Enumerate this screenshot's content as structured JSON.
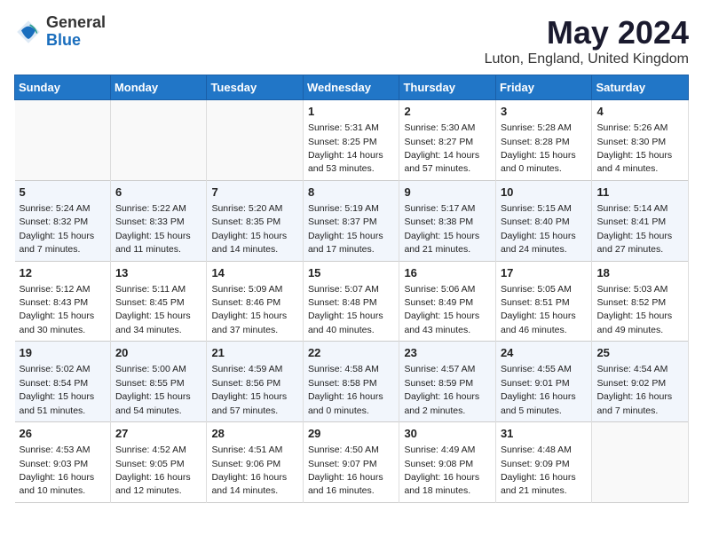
{
  "header": {
    "logo_general": "General",
    "logo_blue": "Blue",
    "title": "May 2024",
    "subtitle": "Luton, England, United Kingdom"
  },
  "days_header": [
    "Sunday",
    "Monday",
    "Tuesday",
    "Wednesday",
    "Thursday",
    "Friday",
    "Saturday"
  ],
  "weeks": [
    [
      {
        "num": "",
        "info": ""
      },
      {
        "num": "",
        "info": ""
      },
      {
        "num": "",
        "info": ""
      },
      {
        "num": "1",
        "info": "Sunrise: 5:31 AM\nSunset: 8:25 PM\nDaylight: 14 hours\nand 53 minutes."
      },
      {
        "num": "2",
        "info": "Sunrise: 5:30 AM\nSunset: 8:27 PM\nDaylight: 14 hours\nand 57 minutes."
      },
      {
        "num": "3",
        "info": "Sunrise: 5:28 AM\nSunset: 8:28 PM\nDaylight: 15 hours\nand 0 minutes."
      },
      {
        "num": "4",
        "info": "Sunrise: 5:26 AM\nSunset: 8:30 PM\nDaylight: 15 hours\nand 4 minutes."
      }
    ],
    [
      {
        "num": "5",
        "info": "Sunrise: 5:24 AM\nSunset: 8:32 PM\nDaylight: 15 hours\nand 7 minutes."
      },
      {
        "num": "6",
        "info": "Sunrise: 5:22 AM\nSunset: 8:33 PM\nDaylight: 15 hours\nand 11 minutes."
      },
      {
        "num": "7",
        "info": "Sunrise: 5:20 AM\nSunset: 8:35 PM\nDaylight: 15 hours\nand 14 minutes."
      },
      {
        "num": "8",
        "info": "Sunrise: 5:19 AM\nSunset: 8:37 PM\nDaylight: 15 hours\nand 17 minutes."
      },
      {
        "num": "9",
        "info": "Sunrise: 5:17 AM\nSunset: 8:38 PM\nDaylight: 15 hours\nand 21 minutes."
      },
      {
        "num": "10",
        "info": "Sunrise: 5:15 AM\nSunset: 8:40 PM\nDaylight: 15 hours\nand 24 minutes."
      },
      {
        "num": "11",
        "info": "Sunrise: 5:14 AM\nSunset: 8:41 PM\nDaylight: 15 hours\nand 27 minutes."
      }
    ],
    [
      {
        "num": "12",
        "info": "Sunrise: 5:12 AM\nSunset: 8:43 PM\nDaylight: 15 hours\nand 30 minutes."
      },
      {
        "num": "13",
        "info": "Sunrise: 5:11 AM\nSunset: 8:45 PM\nDaylight: 15 hours\nand 34 minutes."
      },
      {
        "num": "14",
        "info": "Sunrise: 5:09 AM\nSunset: 8:46 PM\nDaylight: 15 hours\nand 37 minutes."
      },
      {
        "num": "15",
        "info": "Sunrise: 5:07 AM\nSunset: 8:48 PM\nDaylight: 15 hours\nand 40 minutes."
      },
      {
        "num": "16",
        "info": "Sunrise: 5:06 AM\nSunset: 8:49 PM\nDaylight: 15 hours\nand 43 minutes."
      },
      {
        "num": "17",
        "info": "Sunrise: 5:05 AM\nSunset: 8:51 PM\nDaylight: 15 hours\nand 46 minutes."
      },
      {
        "num": "18",
        "info": "Sunrise: 5:03 AM\nSunset: 8:52 PM\nDaylight: 15 hours\nand 49 minutes."
      }
    ],
    [
      {
        "num": "19",
        "info": "Sunrise: 5:02 AM\nSunset: 8:54 PM\nDaylight: 15 hours\nand 51 minutes."
      },
      {
        "num": "20",
        "info": "Sunrise: 5:00 AM\nSunset: 8:55 PM\nDaylight: 15 hours\nand 54 minutes."
      },
      {
        "num": "21",
        "info": "Sunrise: 4:59 AM\nSunset: 8:56 PM\nDaylight: 15 hours\nand 57 minutes."
      },
      {
        "num": "22",
        "info": "Sunrise: 4:58 AM\nSunset: 8:58 PM\nDaylight: 16 hours\nand 0 minutes."
      },
      {
        "num": "23",
        "info": "Sunrise: 4:57 AM\nSunset: 8:59 PM\nDaylight: 16 hours\nand 2 minutes."
      },
      {
        "num": "24",
        "info": "Sunrise: 4:55 AM\nSunset: 9:01 PM\nDaylight: 16 hours\nand 5 minutes."
      },
      {
        "num": "25",
        "info": "Sunrise: 4:54 AM\nSunset: 9:02 PM\nDaylight: 16 hours\nand 7 minutes."
      }
    ],
    [
      {
        "num": "26",
        "info": "Sunrise: 4:53 AM\nSunset: 9:03 PM\nDaylight: 16 hours\nand 10 minutes."
      },
      {
        "num": "27",
        "info": "Sunrise: 4:52 AM\nSunset: 9:05 PM\nDaylight: 16 hours\nand 12 minutes."
      },
      {
        "num": "28",
        "info": "Sunrise: 4:51 AM\nSunset: 9:06 PM\nDaylight: 16 hours\nand 14 minutes."
      },
      {
        "num": "29",
        "info": "Sunrise: 4:50 AM\nSunset: 9:07 PM\nDaylight: 16 hours\nand 16 minutes."
      },
      {
        "num": "30",
        "info": "Sunrise: 4:49 AM\nSunset: 9:08 PM\nDaylight: 16 hours\nand 18 minutes."
      },
      {
        "num": "31",
        "info": "Sunrise: 4:48 AM\nSunset: 9:09 PM\nDaylight: 16 hours\nand 21 minutes."
      },
      {
        "num": "",
        "info": ""
      }
    ]
  ]
}
